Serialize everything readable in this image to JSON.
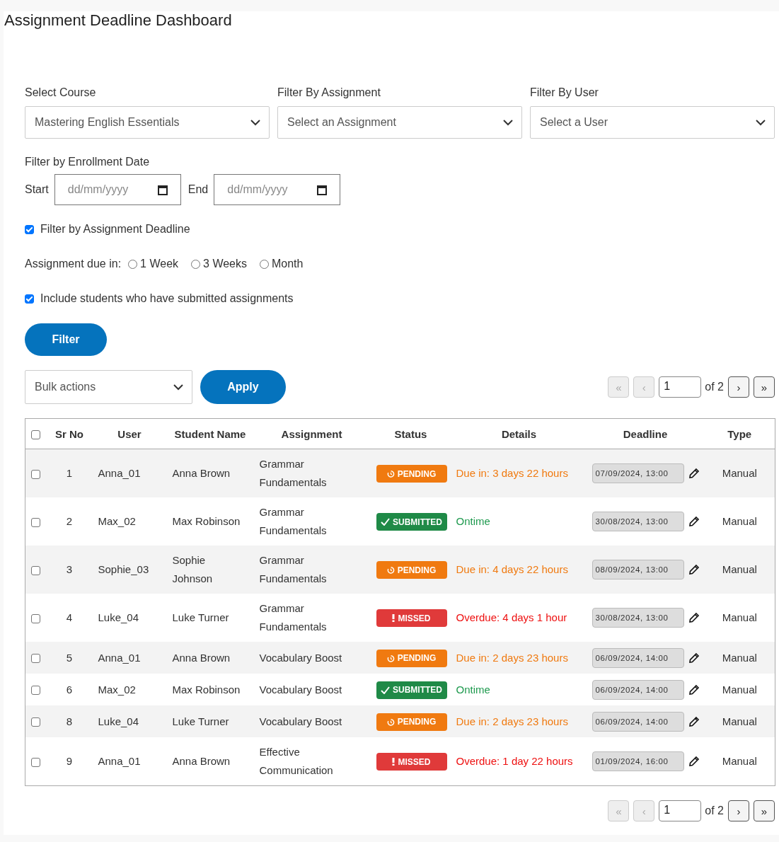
{
  "title": "Assignment Deadline Dashboard",
  "filters": [
    {
      "label": "Select Course",
      "value": "Mastering English Essentials"
    },
    {
      "label": "Filter By Assignment",
      "value": "Select an Assignment"
    },
    {
      "label": "Filter By User",
      "value": "Select a User"
    }
  ],
  "enrollment": {
    "label": "Filter by Enrollment Date",
    "start_label": "Start",
    "start_placeholder": "dd/mm/yyyy",
    "end_label": "End",
    "end_placeholder": "dd/mm/yyyy"
  },
  "deadline_filter": {
    "label": "Filter by Assignment Deadline",
    "checked": true
  },
  "due_in": {
    "label": "Assignment due in:",
    "options": [
      {
        "label": "1 Week",
        "selected": false
      },
      {
        "label": "3 Weeks",
        "selected": false
      },
      {
        "label": "Month",
        "selected": false
      }
    ]
  },
  "include_submitted": {
    "label": "Include students who have submitted assignments",
    "checked": true
  },
  "filter_button": "Filter",
  "bulk_actions": {
    "value": "Bulk actions",
    "apply": "Apply"
  },
  "pagination_top": {
    "first": {
      "label": "«",
      "disabled": true
    },
    "prev": {
      "label": "‹",
      "disabled": true
    },
    "page": "1",
    "of": "of 2",
    "next": {
      "label": "›",
      "disabled": false
    },
    "last": {
      "label": "»",
      "disabled": false
    }
  },
  "table": {
    "select_all": {
      "checked": false
    },
    "columns": [
      "Sr No",
      "User",
      "Student Name",
      "Assignment",
      "Status",
      "Details",
      "Deadline",
      "Type"
    ],
    "rows": [
      {
        "checked": false,
        "sr": "1",
        "user": "Anna_01",
        "student": "Anna Brown",
        "assignment": "Grammar Fundamentals",
        "status": {
          "kind": "pending",
          "label": "PENDING"
        },
        "details": "Due in: 3 days 22 hours",
        "deadline": "07/09/2024, 13:00",
        "type": "Manual"
      },
      {
        "checked": false,
        "sr": "2",
        "user": "Max_02",
        "student": "Max Robinson",
        "assignment": "Grammar Fundamentals",
        "status": {
          "kind": "submitted",
          "label": "SUBMITTED"
        },
        "details": "Ontime",
        "deadline": "30/08/2024, 13:00",
        "type": "Manual"
      },
      {
        "checked": false,
        "sr": "3",
        "user": "Sophie_03",
        "student": "Sophie Johnson",
        "assignment": "Grammar Fundamentals",
        "status": {
          "kind": "pending",
          "label": "PENDING"
        },
        "details": "Due in: 4 days 22 hours",
        "deadline": "08/09/2024, 13:00",
        "type": "Manual"
      },
      {
        "checked": false,
        "sr": "4",
        "user": "Luke_04",
        "student": "Luke Turner",
        "assignment": "Grammar Fundamentals",
        "status": {
          "kind": "missed",
          "label": "MISSED"
        },
        "details": "Overdue: 4 days 1 hour",
        "deadline": "30/08/2024, 13:00",
        "type": "Manual"
      },
      {
        "checked": false,
        "sr": "5",
        "user": "Anna_01",
        "student": "Anna Brown",
        "assignment": "Vocabulary Boost",
        "status": {
          "kind": "pending",
          "label": "PENDING"
        },
        "details": "Due in: 2 days 23 hours",
        "deadline": "06/09/2024, 14:00",
        "type": "Manual"
      },
      {
        "checked": false,
        "sr": "6",
        "user": "Max_02",
        "student": "Max Robinson",
        "assignment": "Vocabulary Boost",
        "status": {
          "kind": "submitted",
          "label": "SUBMITTED"
        },
        "details": "Ontime",
        "deadline": "06/09/2024, 14:00",
        "type": "Manual"
      },
      {
        "checked": false,
        "sr": "8",
        "user": "Luke_04",
        "student": "Luke Turner",
        "assignment": "Vocabulary Boost",
        "status": {
          "kind": "pending",
          "label": "PENDING"
        },
        "details": "Due in: 2 days 23 hours",
        "deadline": "06/09/2024, 14:00",
        "type": "Manual"
      },
      {
        "checked": false,
        "sr": "9",
        "user": "Anna_01",
        "student": "Anna Brown",
        "assignment": "Effective Communication",
        "status": {
          "kind": "missed",
          "label": "MISSED"
        },
        "details": "Overdue: 1 day 22 hours",
        "deadline": "01/09/2024, 16:00",
        "type": "Manual"
      }
    ]
  },
  "pagination_bottom": {
    "first": {
      "label": "«",
      "disabled": true
    },
    "prev": {
      "label": "‹",
      "disabled": true
    },
    "page": "1",
    "of": "of 2",
    "next": {
      "label": "›",
      "disabled": false
    },
    "last": {
      "label": "»",
      "disabled": false
    }
  }
}
